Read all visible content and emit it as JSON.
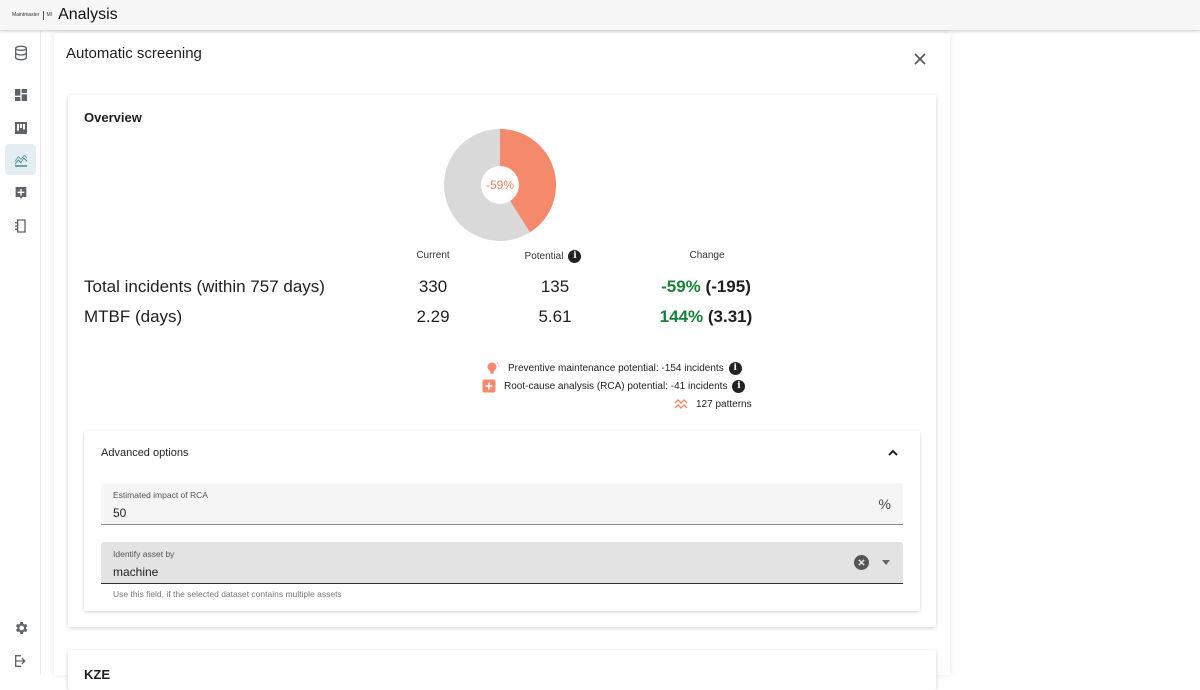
{
  "app": {
    "logo_text": "Maintmaster",
    "logo_suffix": "MI",
    "title": "Analysis"
  },
  "sidebar": {
    "icons": [
      "database-icon",
      "dashboard-icon",
      "board-icon",
      "analysis-icon",
      "report-icon",
      "notebook-icon",
      "settings-icon",
      "logout-icon"
    ],
    "active": "analysis-icon"
  },
  "dialog": {
    "title": "Automatic screening"
  },
  "overview": {
    "title": "Overview",
    "donut": {
      "label": "-59%",
      "fraction": 0.41,
      "color_potential": "#f4896b",
      "color_rest": "#d9d9d9"
    },
    "columns": {
      "current": "Current",
      "potential": "Potential",
      "change": "Change"
    },
    "rows": [
      {
        "label": "Total incidents (within 757 days)",
        "current": "330",
        "potential": "135",
        "change_pct": "-59%",
        "change_abs": "(-195)"
      },
      {
        "label": "MTBF (days)",
        "current": "2.29",
        "potential": "5.61",
        "change_pct": "144%",
        "change_abs": "(3.31)"
      }
    ],
    "potentials": [
      {
        "icon": "lightbulb-icon",
        "text": "Preventive maintenance potential: -154 incidents"
      },
      {
        "icon": "rca-icon",
        "text": "Root-cause analysis (RCA) potential: -41 incidents"
      },
      {
        "icon": "pattern-icon",
        "text": "127 patterns"
      }
    ]
  },
  "advanced": {
    "title": "Advanced options",
    "rca_field": {
      "label": "Estimated impact of RCA",
      "value": "50",
      "suffix": "%"
    },
    "asset_field": {
      "label": "Identify asset by",
      "value": "machine",
      "hint": "Use this field, if the selected dataset contains multiple assets"
    }
  },
  "next_card": {
    "title": "KZE"
  },
  "colors": {
    "accent": "#2f7c86",
    "positive": "#188038",
    "orange": "#f4896b"
  }
}
